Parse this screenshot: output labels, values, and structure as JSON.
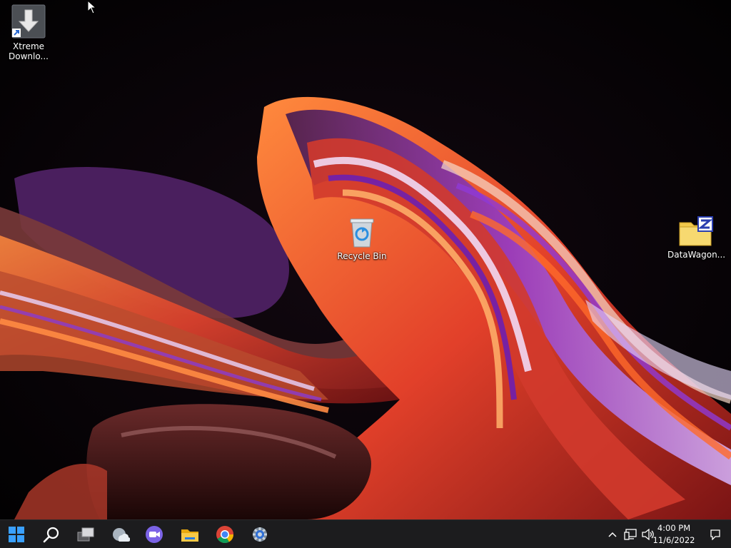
{
  "desktop": {
    "icons": [
      {
        "label": "Xtreme\nDownlo...",
        "line1": "Xtreme",
        "line2": "Downlo...",
        "icon": "download-arrow-icon"
      },
      {
        "label": "Recycle Bin",
        "icon": "recycle-bin-icon"
      },
      {
        "label": "DataWagon...",
        "icon": "zip-folder-icon"
      }
    ]
  },
  "taskbar": {
    "buttons": [
      {
        "name": "start",
        "icon": "windows-logo-icon"
      },
      {
        "name": "search",
        "icon": "search-icon"
      },
      {
        "name": "task-view",
        "icon": "task-view-icon"
      },
      {
        "name": "widgets",
        "icon": "weather-widget-icon"
      },
      {
        "name": "teams-chat",
        "icon": "teams-chat-icon"
      },
      {
        "name": "file-explorer",
        "icon": "file-explorer-icon"
      },
      {
        "name": "chrome",
        "icon": "chrome-icon"
      },
      {
        "name": "settings",
        "icon": "settings-gear-icon"
      }
    ],
    "tray": {
      "time": "4:00 PM",
      "date": "11/6/2022"
    }
  },
  "colors": {
    "taskbar_bg": "#1c1c1e",
    "windows_blue": "#0a84ff",
    "folder_yellow": "#f2c94c"
  }
}
